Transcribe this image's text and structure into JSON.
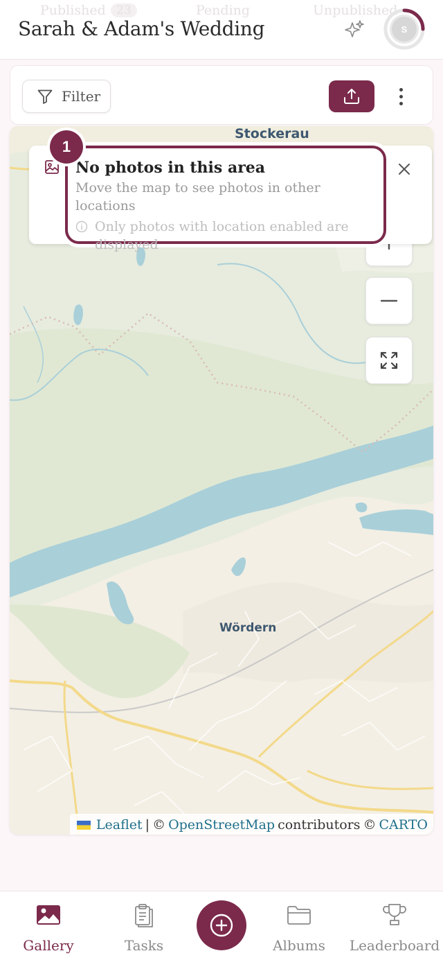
{
  "header": {
    "title": "Sarah & Adam's Wedding",
    "avatar_initial": "S",
    "ghost_tabs": {
      "published": "Published",
      "published_count": "23",
      "pending": "Pending",
      "unpublished": "Unpublished"
    }
  },
  "toolbar": {
    "filter_label": "Filter"
  },
  "map": {
    "labels": {
      "town_top": "Stockerau",
      "town_mid": "Wördern"
    },
    "attribution": {
      "leaflet": "Leaflet",
      "sep": "|",
      "copy1": "©",
      "osm": "OpenStreetMap",
      "contributors": "contributors",
      "copy2": "©",
      "carto": "CARTO"
    }
  },
  "notice": {
    "step": "1",
    "title": "No photos in this area",
    "subtitle": "Move the map to see photos in other locations",
    "note": "Only photos with location enabled are displayed"
  },
  "nav": {
    "items": [
      {
        "label": "Gallery",
        "icon": "image-icon",
        "active": true
      },
      {
        "label": "Tasks",
        "icon": "clipboard-icon",
        "active": false
      },
      {
        "label": "Albums",
        "icon": "folder-icon",
        "active": false
      },
      {
        "label": "Leaderboard",
        "icon": "trophy-icon",
        "active": false
      }
    ],
    "fab_icon": "plus-circle-icon"
  },
  "colors": {
    "accent": "#7b2a4b",
    "water": "#a9cfd9",
    "land": "#e7ecde",
    "urban": "#f4efe3",
    "link": "#1f6f8b"
  }
}
